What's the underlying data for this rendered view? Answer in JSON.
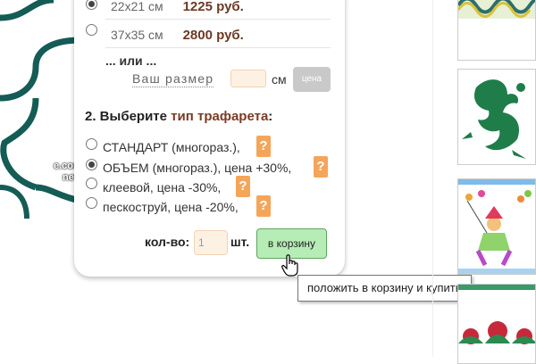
{
  "sizes": [
    {
      "label": "22x21 см",
      "price": "1225 руб.",
      "selected": true
    },
    {
      "label": "37x35 см",
      "price": "2800 руб.",
      "selected": false
    }
  ],
  "custom_size": {
    "or_text": "... или ...",
    "label": "Ваш размер",
    "value": "",
    "unit": "см",
    "price_button": "цена"
  },
  "step2": {
    "prefix": "2. Выберите ",
    "link": "тип трафарета",
    "suffix": ":"
  },
  "types": [
    {
      "label": "СТАНДАРТ (многораз.),",
      "selected": false
    },
    {
      "label": "ОБЪЕМ (многораз.), цена +30%,",
      "selected": true
    },
    {
      "label": "клеевой, цена -30%,",
      "selected": false
    },
    {
      "label": "пескоструй, цена -20%,",
      "selected": false
    }
  ],
  "help_symbol": "?",
  "quantity": {
    "label": "кол-во:",
    "value": "1",
    "unit": "шт."
  },
  "cart_button": "в корзину",
  "tooltip": "положить в корзину и купить",
  "watermark": {
    "line1": "e.com",
    "line2": "net"
  },
  "colors": {
    "accent_orange": "#f5a55a",
    "cart_green": "#b6ecb6",
    "link_brown": "#7a3b22",
    "deco_teal": "#145c55"
  }
}
